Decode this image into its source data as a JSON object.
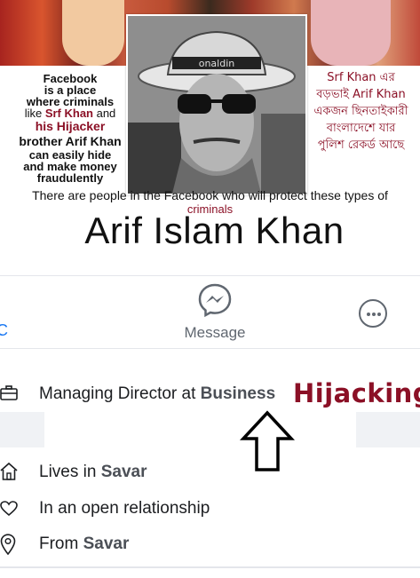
{
  "overlay_left": {
    "line1": "Facebook",
    "line2": "is a place",
    "line3": "where criminals",
    "line4_pre": "like ",
    "line4_name": "Srf Khan",
    "line4_post": " and",
    "line5": "his Hijacker",
    "line6": "brother Arif Khan",
    "line7": "can easily hide",
    "line8": "and make money",
    "line9": "fraudulently"
  },
  "overlay_right": {
    "line1": "Srf Khan এর",
    "line2": "বড়ভাই Arif Khan",
    "line3": "একজন ছিনতাইকারী",
    "line4": "বাংলাদেশে যার",
    "line5": "পুলিশ রেকর্ড আছে"
  },
  "caption": {
    "text": "There are people in the Facebook who will protect these types of",
    "highlight": "criminals"
  },
  "profile": {
    "name": "Arif Islam Khan"
  },
  "actions": {
    "message_label": "Message",
    "left_edge_glyph": "C"
  },
  "info": {
    "work_prefix": "Managing Director at ",
    "work_place": "Business",
    "lives_prefix": "Lives in ",
    "lives_place": "Savar",
    "relationship": "In an open relationship",
    "from_prefix": "From ",
    "from_place": "Savar"
  },
  "annotation": {
    "label": "Hijacking"
  },
  "icons": [
    "messenger-icon",
    "more-icon",
    "briefcase-icon",
    "home-icon",
    "heart-icon",
    "location-pin-icon",
    "up-arrow-icon"
  ],
  "colors": {
    "accent_red": "#8b1026",
    "messenger_blue": "#1877f2",
    "icon_gray": "#606770"
  }
}
